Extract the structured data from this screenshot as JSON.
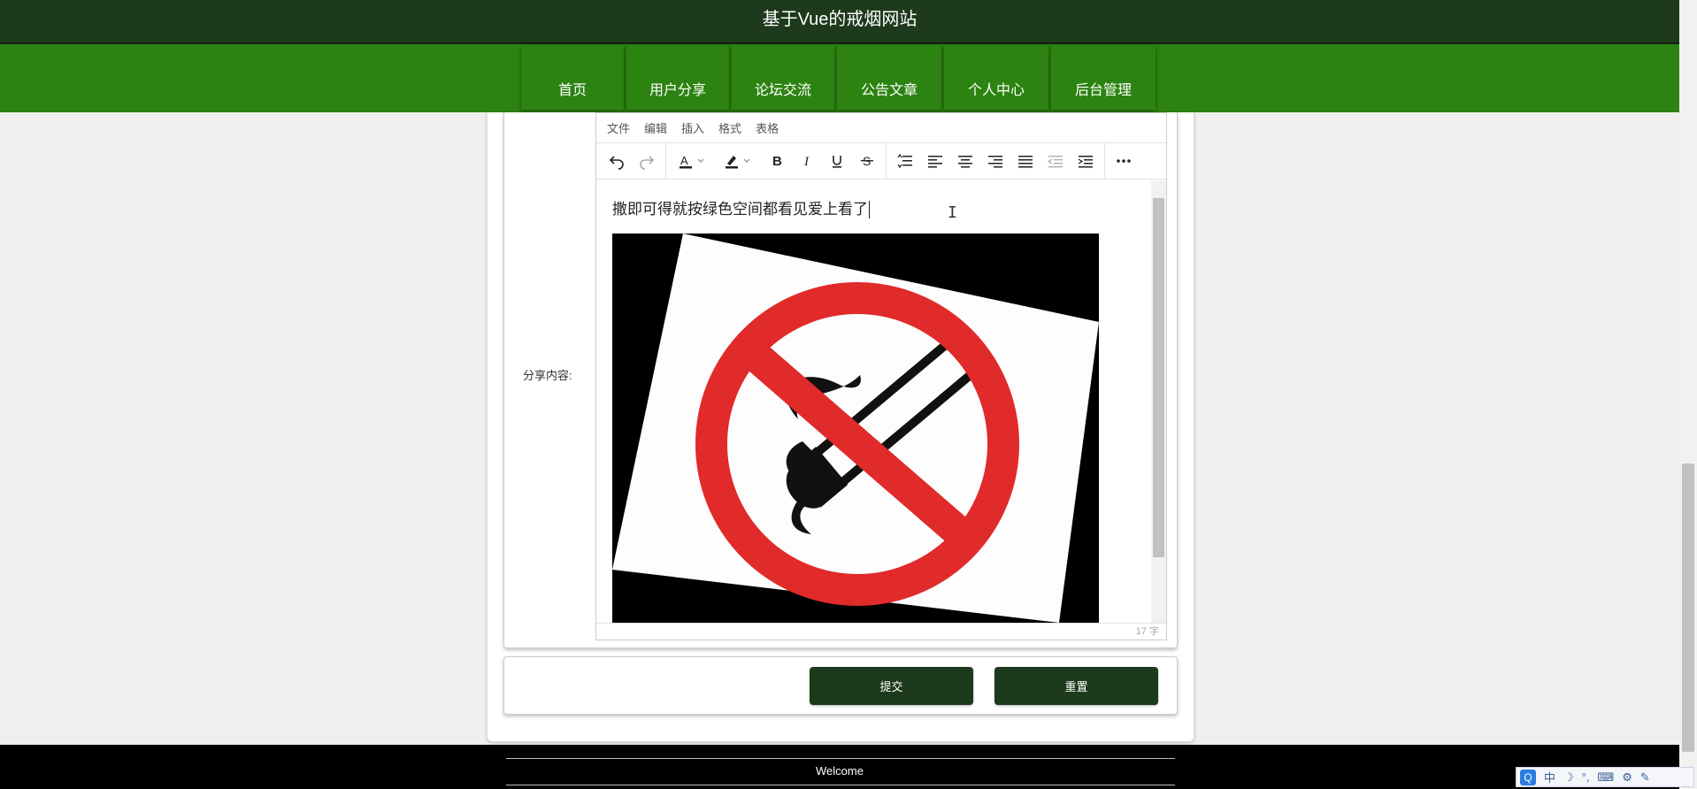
{
  "site": {
    "title": "基于Vue的戒烟网站"
  },
  "nav": {
    "items": [
      {
        "label": "首页"
      },
      {
        "label": "用户分享"
      },
      {
        "label": "论坛交流"
      },
      {
        "label": "公告文章"
      },
      {
        "label": "个人中心"
      },
      {
        "label": "后台管理"
      }
    ]
  },
  "form": {
    "content_label": "分享内容:",
    "editor": {
      "menubar": [
        "文件",
        "编辑",
        "插入",
        "格式",
        "表格"
      ],
      "toolbar": [
        "undo-icon",
        "redo-icon",
        "text-color-icon",
        "highlight-icon",
        "bold-icon",
        "italic-icon",
        "underline-icon",
        "strikethrough-icon",
        "line-height-icon",
        "align-left-icon",
        "align-center-icon",
        "align-right-icon",
        "justify-icon",
        "outdent-icon",
        "indent-icon",
        "more-icon"
      ],
      "content_text": "撒即可得就按绿色空间都看见爱上看了",
      "word_count": "17 字"
    },
    "submit_label": "提交",
    "reset_label": "重置"
  },
  "footer": {
    "text": "Welcome"
  },
  "ime": {
    "mode": "中"
  },
  "colors": {
    "header": "#1e3a1c",
    "nav": "#2d8311",
    "button": "#1e3a1c",
    "footer": "#000000"
  }
}
